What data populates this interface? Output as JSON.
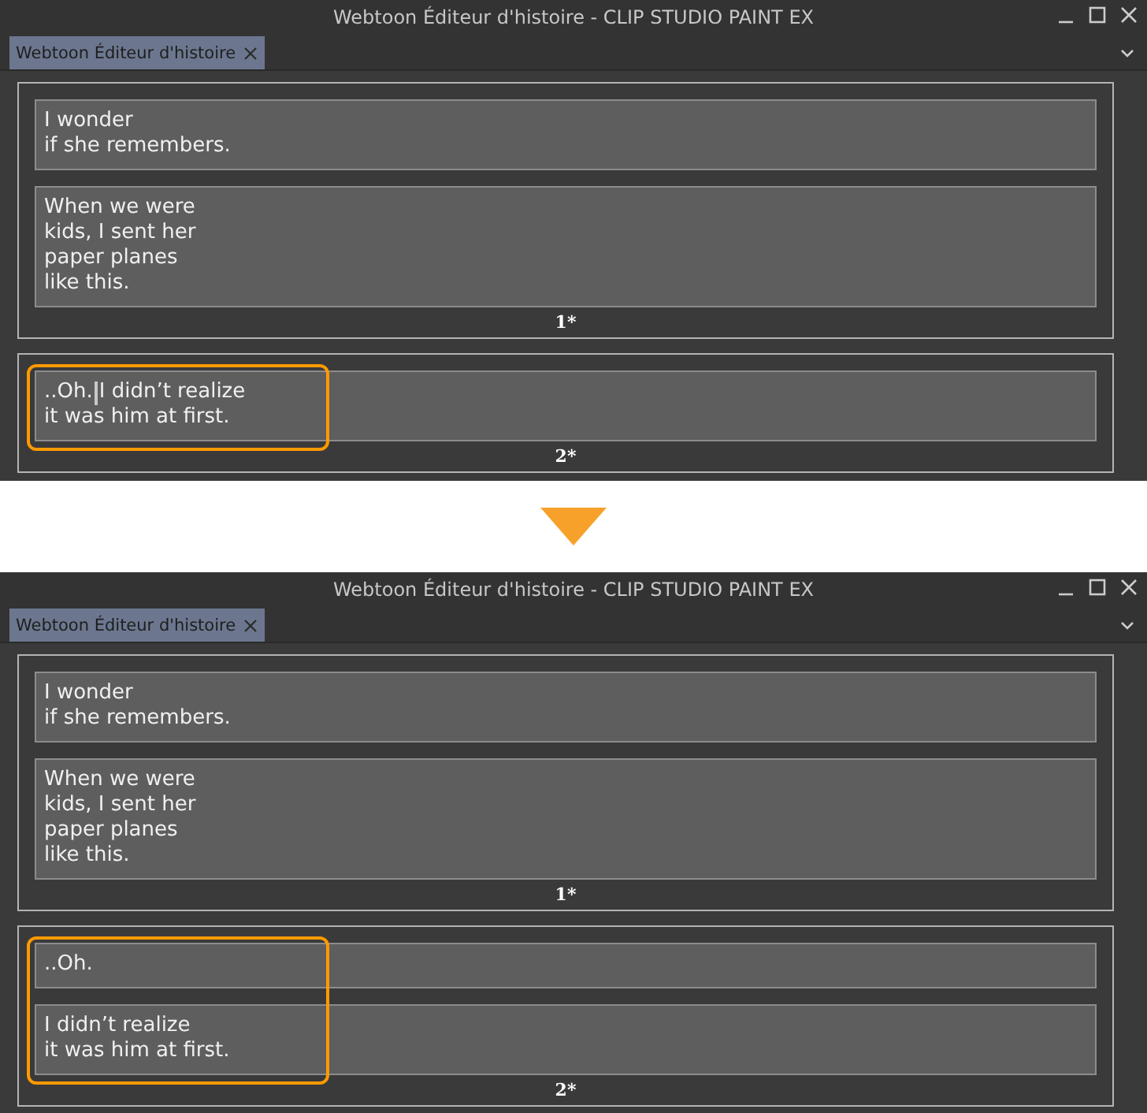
{
  "windows": [
    {
      "title": "Webtoon Éditeur d'histoire - CLIP STUDIO PAINT EX",
      "tab": {
        "label": "Webtoon Éditeur d'histoire",
        "selected": true
      },
      "pages": [
        {
          "label": "1*",
          "highlight": false,
          "blocks": [
            {
              "kind": "text",
              "text": "I wonder\nif she remembers."
            },
            {
              "kind": "text",
              "text": "When we were\nkids, I sent her\npaper planes\nlike this."
            }
          ]
        },
        {
          "label": "2*",
          "highlight": true,
          "blocks": [
            {
              "kind": "editing",
              "before_caret": "..Oh.",
              "after_caret_lines": [
                "I didn’t realize",
                "it was him at first."
              ]
            }
          ]
        }
      ]
    },
    {
      "title": "Webtoon Éditeur d'histoire - CLIP STUDIO PAINT EX",
      "tab": {
        "label": "Webtoon Éditeur d'histoire",
        "selected": true
      },
      "pages": [
        {
          "label": "1*",
          "highlight": false,
          "blocks": [
            {
              "kind": "text",
              "text": "I wonder\nif she remembers."
            },
            {
              "kind": "text",
              "text": "When we were\nkids, I sent her\npaper planes\nlike this."
            }
          ]
        },
        {
          "label": "2*",
          "highlight": true,
          "blocks": [
            {
              "kind": "text",
              "text": "..Oh."
            },
            {
              "kind": "text",
              "text": "I didn’t realize\nit was him at first."
            }
          ]
        }
      ]
    }
  ]
}
